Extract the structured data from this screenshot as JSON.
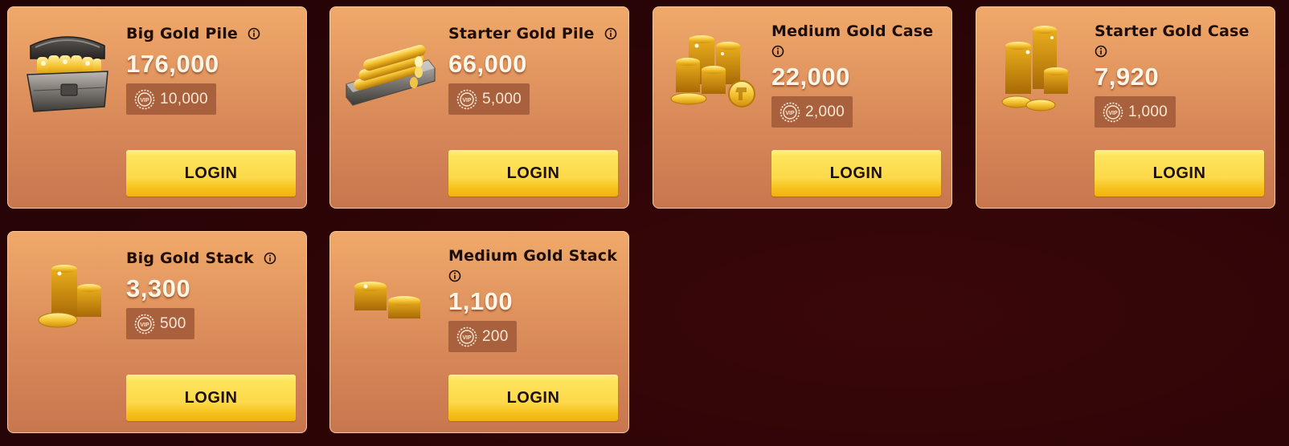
{
  "colors": {
    "background": "#2b0406",
    "card_top": "#f0a96a",
    "card_bottom": "#c8764f",
    "vip_badge": "#a9603c",
    "button_yellow": "#fdd94a"
  },
  "packages": [
    {
      "title": "Big Gold Pile",
      "amount": "176,000",
      "vip": "10,000",
      "button": "LOGIN",
      "icon": "gold-chest-icon"
    },
    {
      "title": "Starter Gold Pile",
      "amount": "66,000",
      "vip": "5,000",
      "button": "LOGIN",
      "icon": "gold-bars-tray-icon"
    },
    {
      "title": "Medium Gold Case",
      "amount": "22,000",
      "vip": "2,000",
      "button": "LOGIN",
      "icon": "gold-coin-stacks-icon"
    },
    {
      "title": "Starter Gold Case",
      "amount": "7,920",
      "vip": "1,000",
      "button": "LOGIN",
      "icon": "gold-coin-tower-icon"
    },
    {
      "title": "Big Gold Stack",
      "amount": "3,300",
      "vip": "500",
      "button": "LOGIN",
      "icon": "gold-coin-stack-icon"
    },
    {
      "title": "Medium Gold Stack",
      "amount": "1,100",
      "vip": "200",
      "button": "LOGIN",
      "icon": "gold-coin-small-stack-icon"
    }
  ]
}
